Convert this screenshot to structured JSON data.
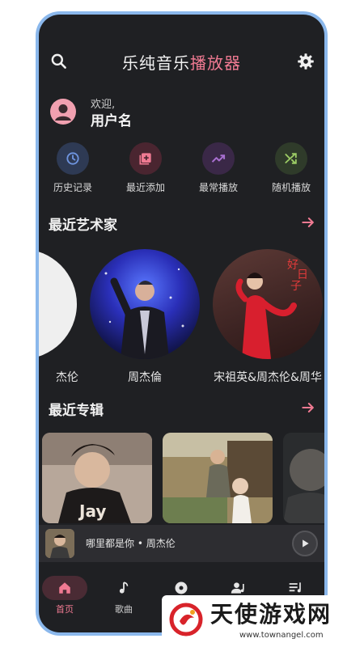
{
  "header": {
    "title_main": "乐纯音乐",
    "title_accent": "播放器"
  },
  "user": {
    "greeting": "欢迎,",
    "name": "用户名"
  },
  "quick_actions": [
    {
      "label": "历史记录",
      "icon": "history-icon",
      "bg": "#2e3a54",
      "fg": "#6f95e0"
    },
    {
      "label": "最近添加",
      "icon": "playlist-add-icon",
      "bg": "#4a2530",
      "fg": "#f07a92"
    },
    {
      "label": "最常播放",
      "icon": "trending-icon",
      "bg": "#3a2847",
      "fg": "#a86fd0"
    },
    {
      "label": "随机播放",
      "icon": "shuffle-icon",
      "bg": "#2f3b2a",
      "fg": "#9ccc65"
    }
  ],
  "sections": {
    "artists_title": "最近艺术家",
    "albums_title": "最近专辑"
  },
  "artists": [
    {
      "name": "杰伦"
    },
    {
      "name": "周杰倫"
    },
    {
      "name": "宋祖英&周杰伦&周华"
    }
  ],
  "albums": [
    {
      "caption": "Jay"
    },
    {
      "caption": ""
    },
    {
      "caption": ""
    }
  ],
  "now_playing": {
    "title": "哪里都是你 • 周杰伦"
  },
  "nav": [
    {
      "label": "首页",
      "icon": "home-icon",
      "active": true
    },
    {
      "label": "歌曲",
      "icon": "music-note-icon",
      "active": false
    },
    {
      "label": "",
      "icon": "album-icon",
      "active": false
    },
    {
      "label": "",
      "icon": "artist-icon",
      "active": false
    },
    {
      "label": "",
      "icon": "queue-icon",
      "active": false
    }
  ],
  "watermark": {
    "text": "天使游戏网",
    "url": "www.townangel.com"
  },
  "colors": {
    "accent": "#f07a92",
    "background": "#1f2023",
    "frame": "#8bb8ec"
  }
}
